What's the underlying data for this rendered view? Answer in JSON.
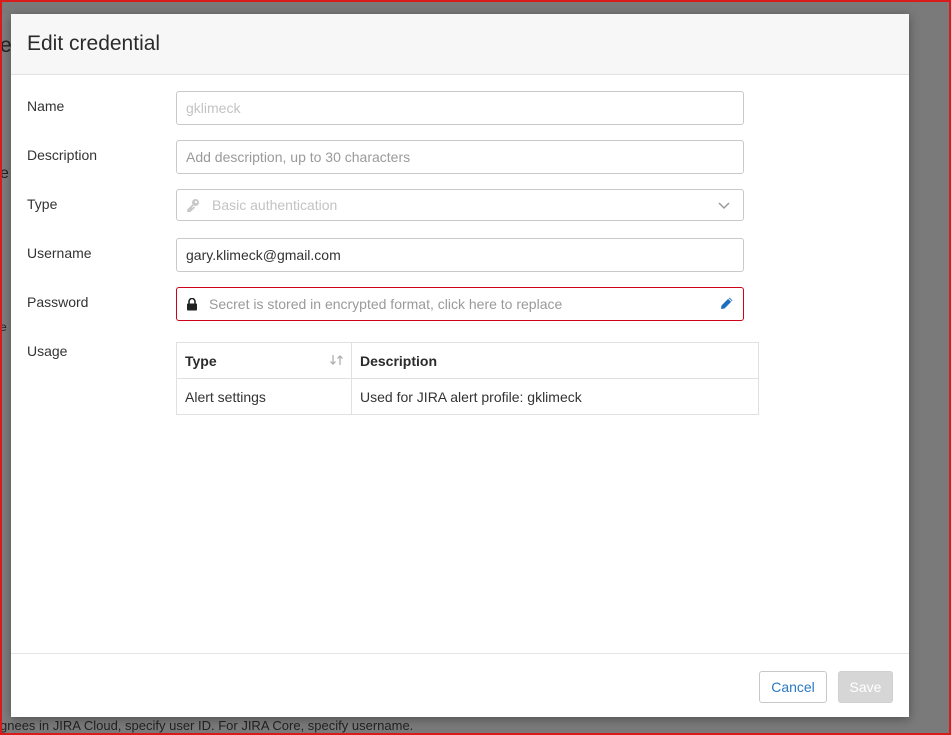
{
  "background": {
    "fragment_title": "e",
    "fragment_mid": "e",
    "fragment_low": "e",
    "hint_text": "gnees in JIRA Cloud, specify user ID. For JIRA Core, specify username."
  },
  "dialog": {
    "title": "Edit credential",
    "fields": {
      "name": {
        "label": "Name",
        "value": "gklimeck"
      },
      "description": {
        "label": "Description",
        "placeholder": "Add description, up to 30 characters"
      },
      "type": {
        "label": "Type",
        "value": "Basic authentication",
        "icon": "key-icon"
      },
      "username": {
        "label": "Username",
        "value": "gary.klimeck@gmail.com"
      },
      "password": {
        "label": "Password",
        "placeholder": "Secret is stored in encrypted format, click here to replace",
        "icon": "lock-icon",
        "action_icon": "pencil-icon"
      },
      "usage": {
        "label": "Usage"
      }
    },
    "usage_table": {
      "columns": [
        "Type",
        "Description"
      ],
      "rows": [
        {
          "type": "Alert settings",
          "description": "Used for JIRA alert profile: gklimeck"
        }
      ]
    },
    "footer": {
      "cancel_label": "Cancel",
      "save_label": "Save"
    }
  },
  "colors": {
    "error_border": "#d0021b",
    "accent_blue": "#2b79c2",
    "frame_red": "#d81b1b"
  }
}
